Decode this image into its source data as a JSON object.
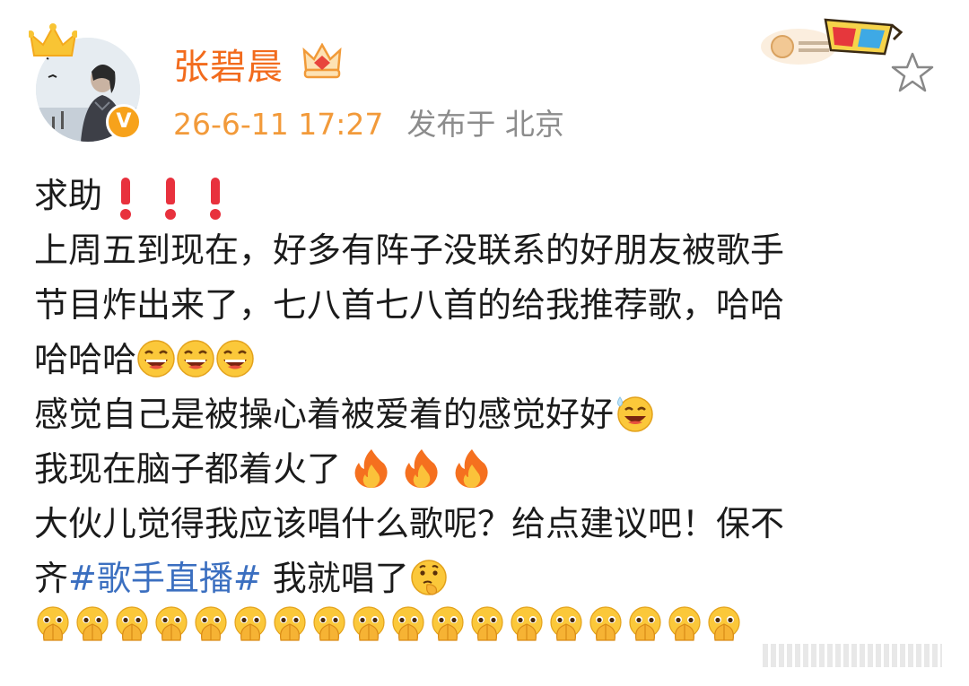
{
  "user": {
    "name": "张碧晨",
    "verified": "V",
    "crown_icon": "crown-icon",
    "vip_icon": "vip-crown-icon"
  },
  "meta": {
    "time": "26-6-11 17:27",
    "location": "发布于 北京"
  },
  "badge_icon": "3d-glasses-badge-icon",
  "colors": {
    "name": "#f26b1d",
    "time": "#f29a3a",
    "hashtag": "#3b6fc0",
    "exclamation": "#e8313d"
  },
  "post": {
    "line1": "求助",
    "line2": "上周五到现在，好多有阵子没联系的好朋友被歌手",
    "line3": "节目炸出来了，七八首七八首的给我推荐歌，哈哈",
    "line4": "哈哈哈",
    "line5": "感觉自己是被操心着被爱着的感觉好好",
    "line6": "我现在脑子都着火了",
    "line7": "大伙儿觉得我应该唱什么歌呢？给点建议吧！保不",
    "line8_before": "齐",
    "hashtag": "#歌手直播#",
    "line8_after": " 我就唱了"
  }
}
